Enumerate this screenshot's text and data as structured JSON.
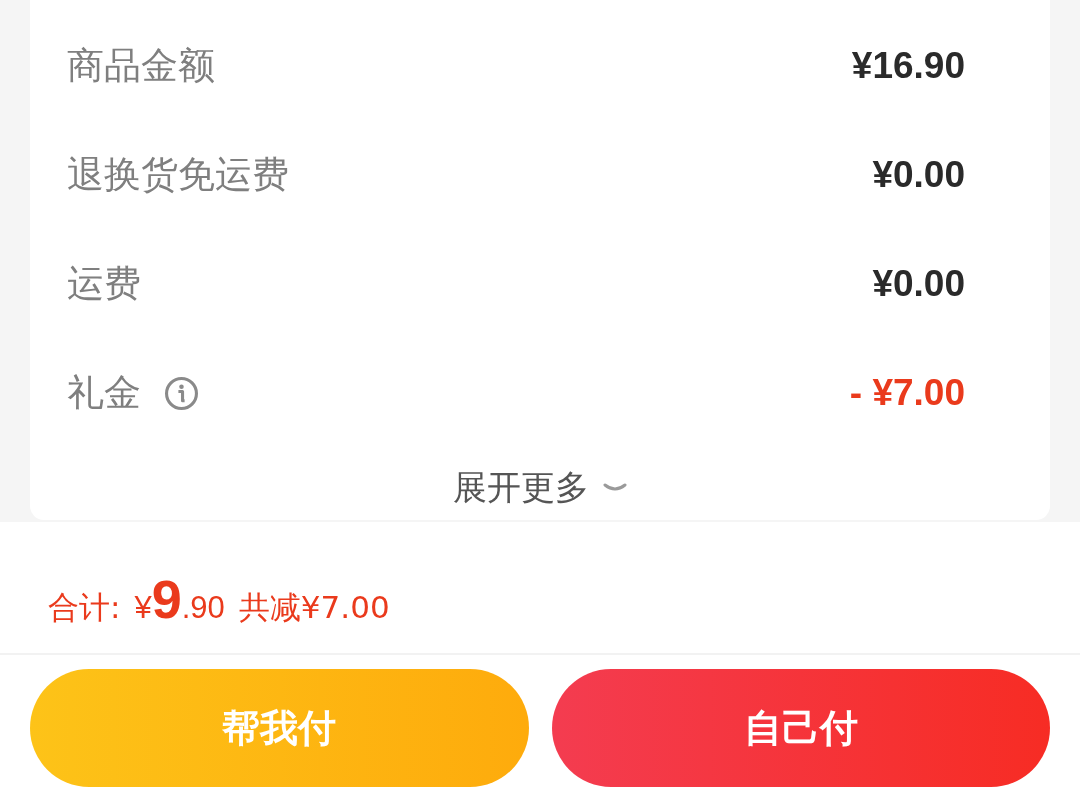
{
  "summary": {
    "rows": [
      {
        "label": "商品金额",
        "value": "¥16.90",
        "kind": "amount",
        "info_icon": false
      },
      {
        "label": "退换货免运费",
        "value": "¥0.00",
        "kind": "amount",
        "info_icon": false
      },
      {
        "label": "运费",
        "value": "¥0.00",
        "kind": "amount",
        "info_icon": false
      },
      {
        "label": "礼金",
        "value": "- ¥7.00",
        "kind": "deduction",
        "info_icon": true
      }
    ],
    "expand": {
      "label": "展开更多",
      "expanded": false
    }
  },
  "total": {
    "label": "合计:",
    "price": {
      "currency": "¥",
      "integer": "9",
      "decimal": ".90"
    },
    "discount": "共减¥7.00"
  },
  "buttons": [
    {
      "label": "帮我付",
      "kind": "secondary"
    },
    {
      "label": "自己付",
      "kind": "primary"
    }
  ]
}
